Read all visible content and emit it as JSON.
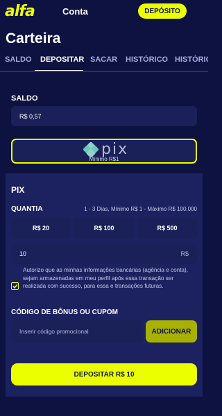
{
  "header": {
    "logo": "alfa",
    "section": "Conta",
    "deposit_button": "DEPÓSITO"
  },
  "page": {
    "title": "Carteira"
  },
  "tabs": [
    {
      "label": "SALDO",
      "active": false
    },
    {
      "label": "DEPOSITAR",
      "active": true
    },
    {
      "label": "SACAR",
      "active": false
    },
    {
      "label": "HISTÓRICO",
      "active": false
    },
    {
      "label": "HISTÓRICO",
      "active": false
    }
  ],
  "balance": {
    "label": "SALDO",
    "value": "R$ 0,57"
  },
  "pix_method": {
    "logo_text": "pix",
    "minimum": "Mínimo R$1",
    "selected": true
  },
  "pix_section": {
    "title": "PIX",
    "amount_label": "QUANTIA",
    "amount_info": "1 - 3 Dias, Mínimo R$ 1 - Máximo R$ 100.000",
    "presets": [
      "R$ 20",
      "R$ 100",
      "R$ 500"
    ],
    "amount_value": "10",
    "currency_suffix": "R$",
    "consent": {
      "checked": true,
      "text": "Autorizo que as minhas informações bancárias (agência e conta), sejam armazenadas em meu perfil após essa transação ser realizada com sucesso, para essa e transações futuras."
    },
    "bonus": {
      "label": "CÓDIGO DE BÔNUS OU CUPOM",
      "placeholder": "Inserir código promocional",
      "add_button": "ADICIONAR"
    },
    "submit_button": "DEPOSITAR R$ 10"
  },
  "colors": {
    "background": "#0d1240",
    "panel": "#1c2260",
    "field": "#1a2058",
    "accent": "#ecff00"
  }
}
